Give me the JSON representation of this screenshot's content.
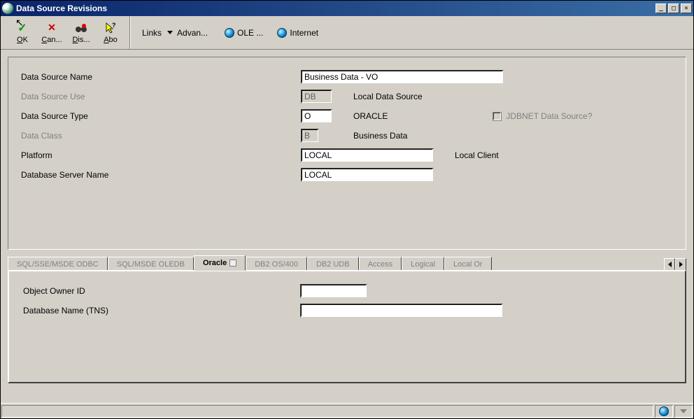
{
  "window": {
    "title": "Data Source Revisions"
  },
  "toolbar": {
    "ok": {
      "label": "OK",
      "accel": "O"
    },
    "can": {
      "label": "Can...",
      "accel": "C"
    },
    "dis": {
      "label": "Dis...",
      "accel": "D"
    },
    "abo": {
      "label": "Abo",
      "accel": "A"
    },
    "links_label": "Links",
    "advan_label": "Advan...",
    "ole_label": "OLE ...",
    "internet_label": "Internet"
  },
  "form": {
    "dsname": {
      "label": "Data Source Name",
      "value": "Business Data - VO"
    },
    "dsuse": {
      "label": "Data Source Use",
      "value": "DB",
      "desc": "Local Data Source"
    },
    "dstype": {
      "label": "Data Source Type",
      "value": "O",
      "desc": "ORACLE"
    },
    "dataclass": {
      "label": "Data Class",
      "value": "B",
      "desc": "Business Data"
    },
    "platform": {
      "label": "Platform",
      "value": "LOCAL",
      "desc": "Local Client"
    },
    "dbserver": {
      "label": "Database Server Name",
      "value": "LOCAL"
    },
    "jdbnet": {
      "label": "JDBNET Data Source?"
    }
  },
  "tabs": [
    "SQL/SSE/MSDE ODBC",
    "SQL/MSDE OLEDB",
    "Oracle",
    "DB2 OS/400",
    "DB2 UDB",
    "Access",
    "Logical",
    "Local Or"
  ],
  "active_tab_index": 2,
  "oracle": {
    "owner": {
      "label": "Object Owner ID",
      "value": ""
    },
    "dbname": {
      "label": "Database Name (TNS)",
      "value": ""
    }
  }
}
